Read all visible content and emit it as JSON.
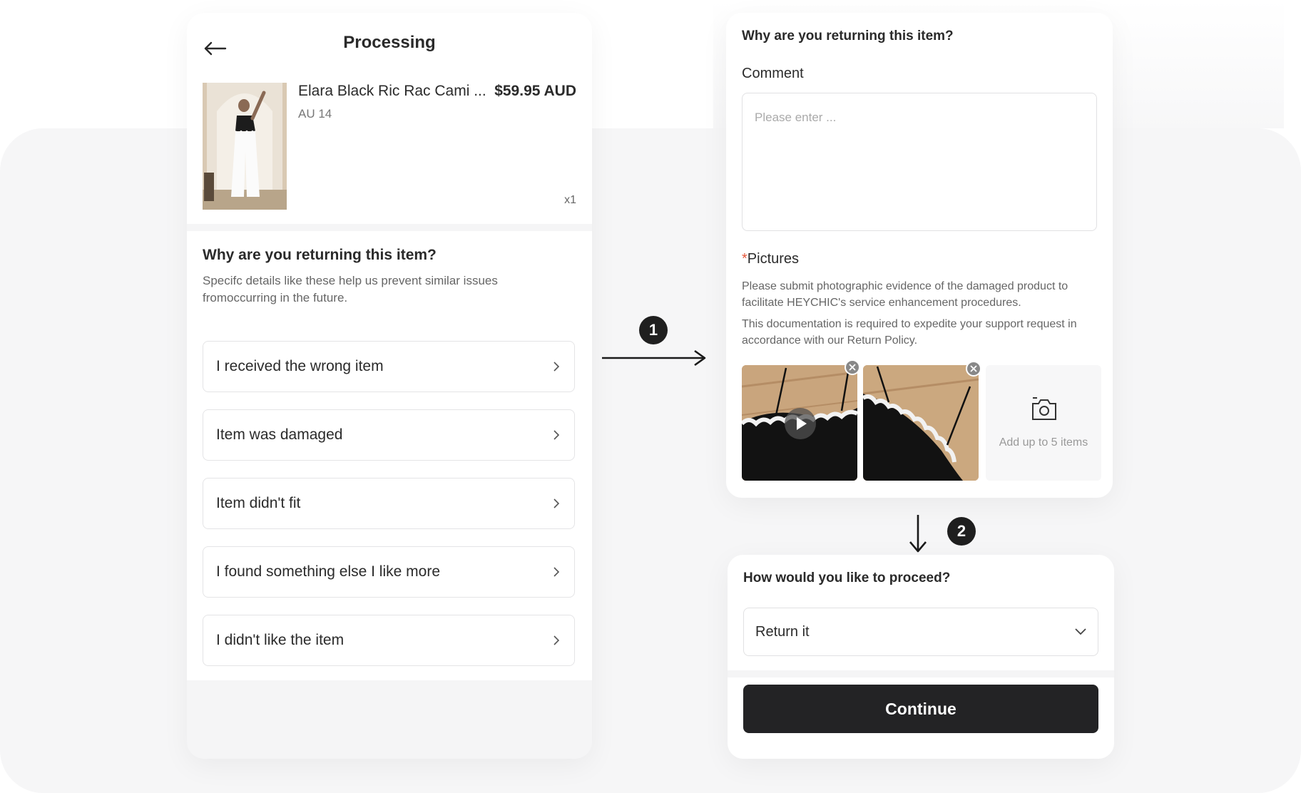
{
  "left_screen": {
    "header": {
      "title": "Processing"
    },
    "product": {
      "name": "Elara Black Ric Rac Cami ...",
      "price": "$59.95 AUD",
      "size": "AU 14",
      "quantity": "x1"
    },
    "reasons": {
      "title": "Why are you returning this item?",
      "subtitle": "Specifc details like these help us prevent similar issues fromoccurring in the future.",
      "items": [
        {
          "label": "I received the wrong item"
        },
        {
          "label": "Item was damaged"
        },
        {
          "label": "Item didn't fit"
        },
        {
          "label": "I found something else I like more"
        },
        {
          "label": "I didn't like the item"
        }
      ]
    }
  },
  "steps": {
    "step1": "1",
    "step2": "2"
  },
  "right_screen": {
    "title": "Why are you returning this item?",
    "comment": {
      "label": "Comment",
      "placeholder": "Please enter ..."
    },
    "pictures": {
      "required_mark": "*",
      "label": "Pictures",
      "description_1": "Please submit photographic evidence of the damaged product to facilitate HEYCHIC's service enhancement procedures.",
      "description_2": "This documentation is required to expedite your support request in accordance with our Return Policy.",
      "add_label": "Add up to 5 items"
    },
    "proceed": {
      "title": "How would you like to proceed?",
      "selected": "Return it",
      "continue_label": "Continue"
    }
  },
  "colors": {
    "accent_dark": "#232325",
    "required_star": "#e5573b"
  }
}
